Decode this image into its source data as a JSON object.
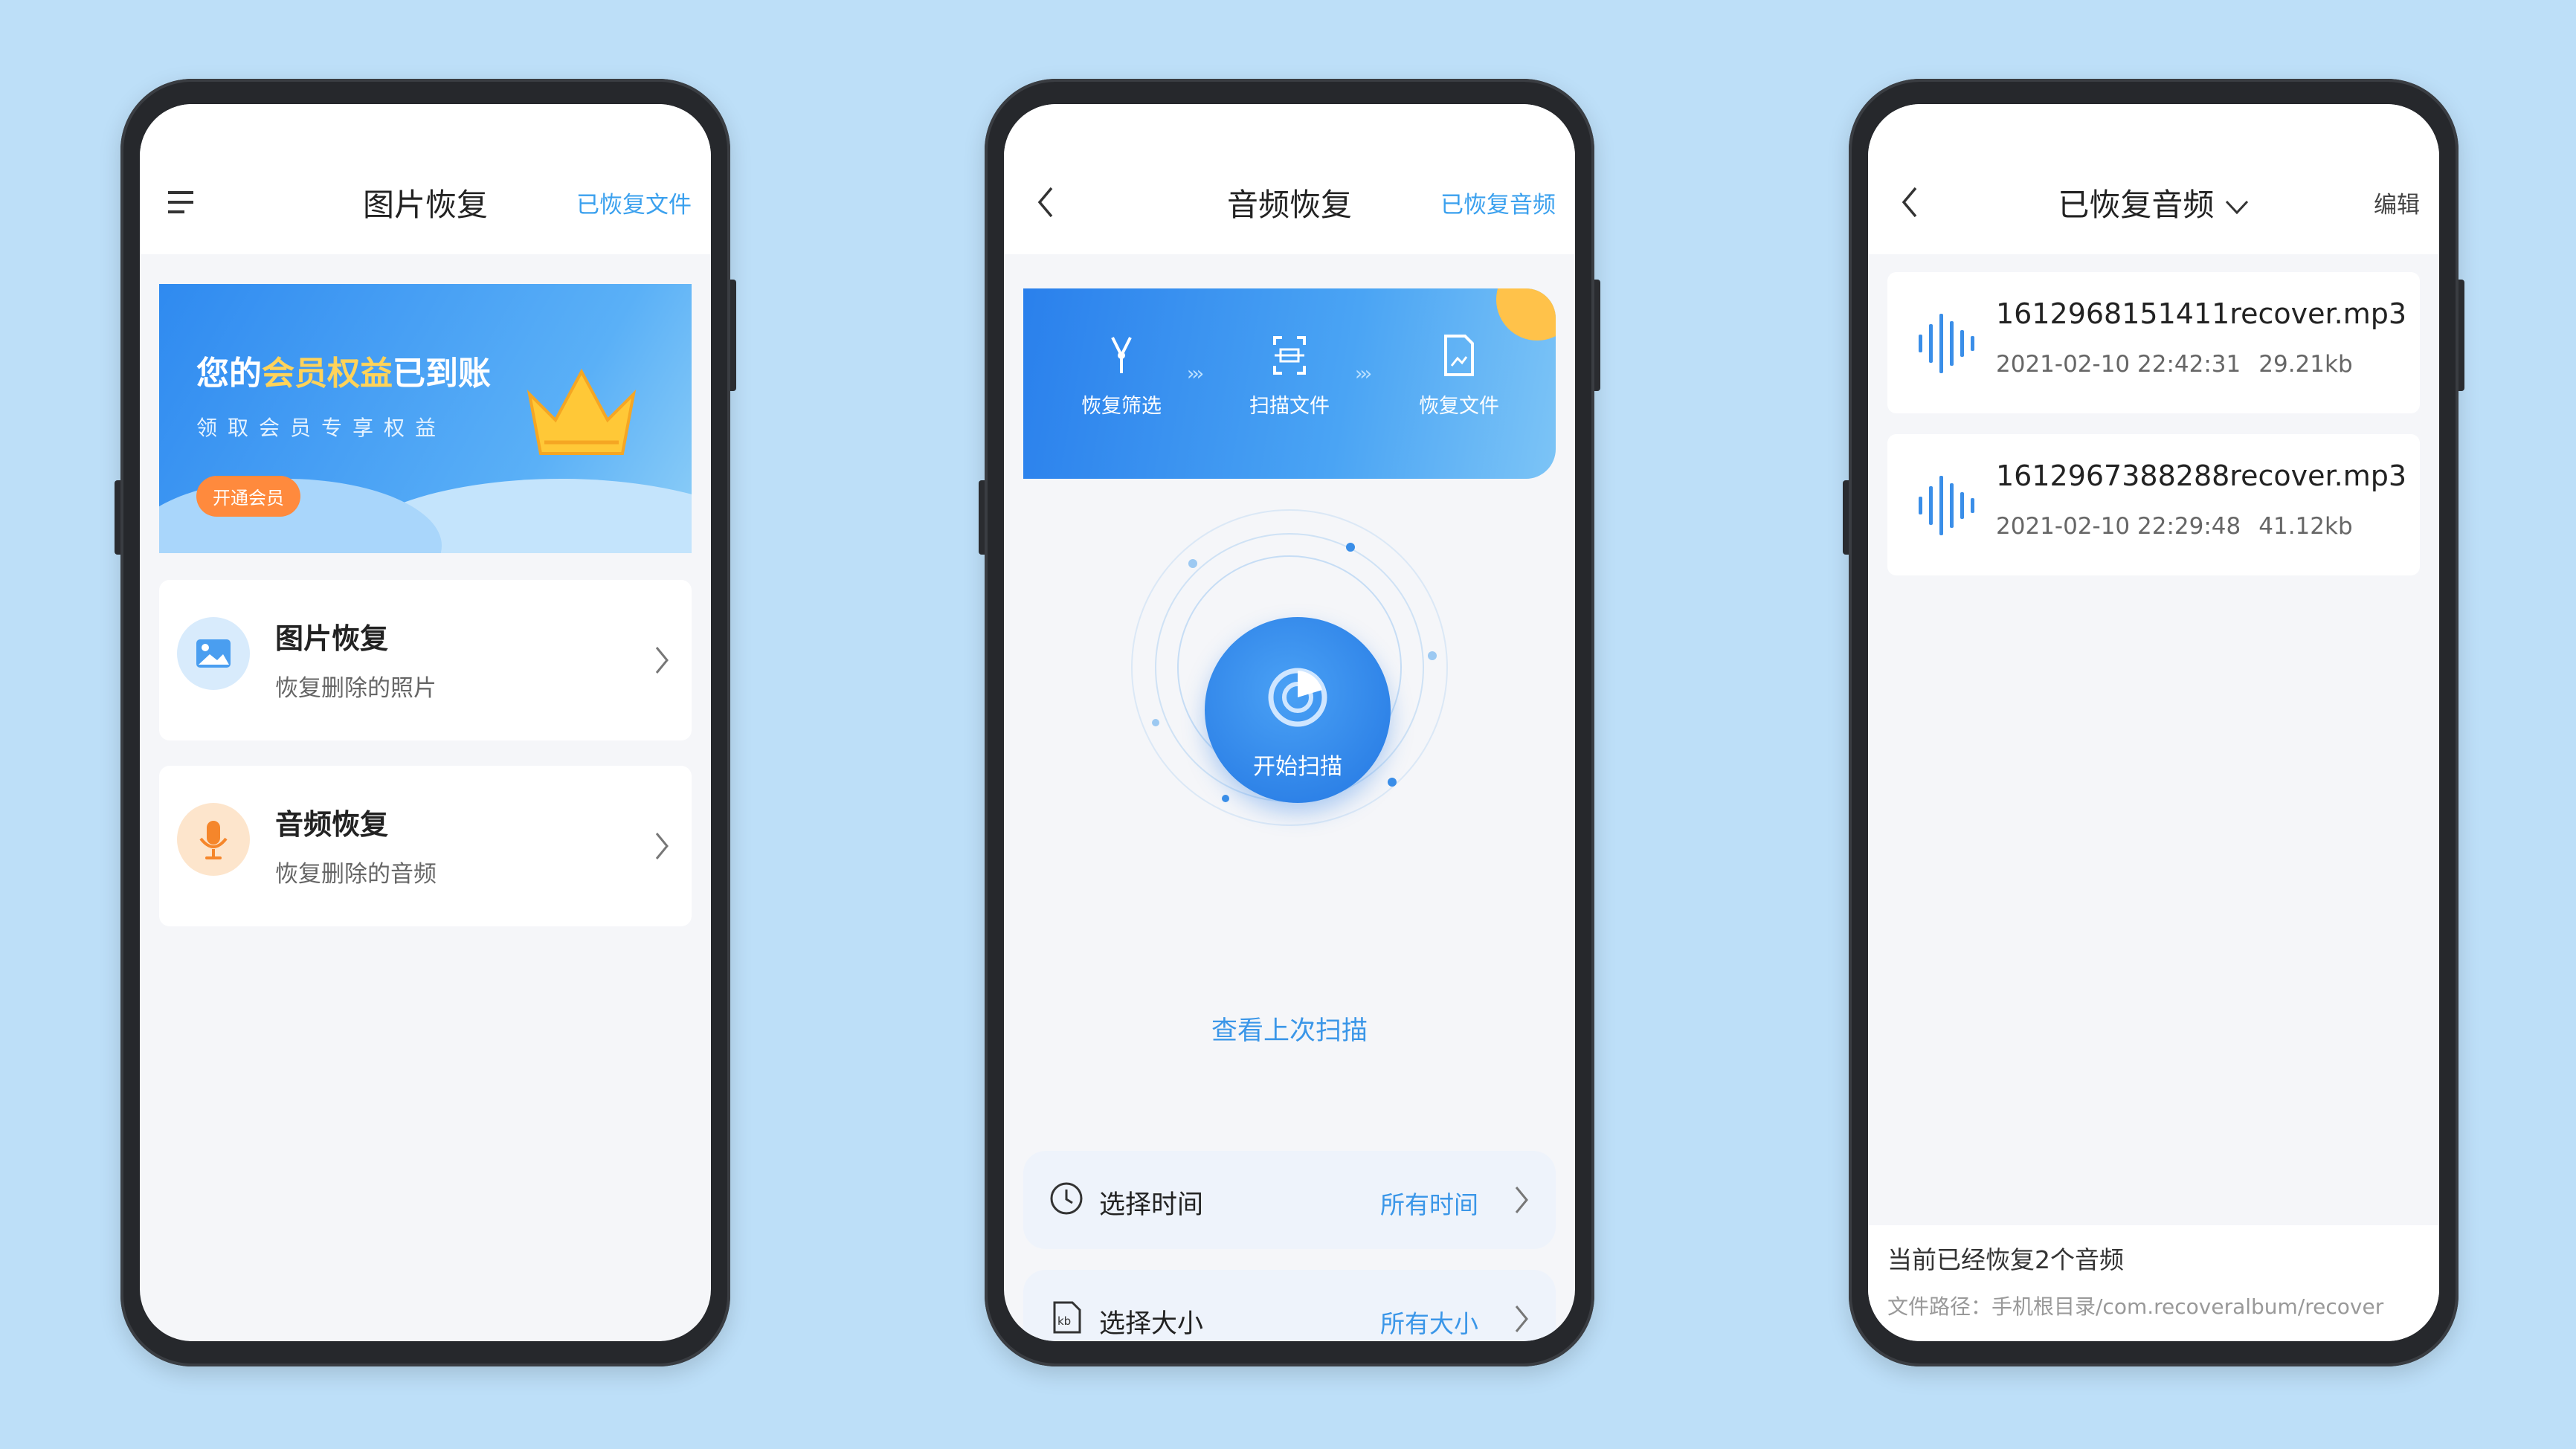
{
  "phone1": {
    "title": "图片恢复",
    "right_action": "已恢复文件",
    "banner": {
      "title_pre": "您的",
      "title_highlight": "会员权益",
      "title_post": "已到账",
      "subtitle": "领取会员专享权益",
      "button": "开通会员"
    },
    "menu": [
      {
        "title": "图片恢复",
        "subtitle": "恢复删除的照片",
        "icon": "image-icon"
      },
      {
        "title": "音频恢复",
        "subtitle": "恢复删除的音频",
        "icon": "microphone-icon"
      }
    ]
  },
  "phone2": {
    "title": "音频恢复",
    "right_action": "已恢复音频",
    "steps": [
      "恢复筛选",
      "扫描文件",
      "恢复文件"
    ],
    "scan_button": "开始扫描",
    "last_scan": "查看上次扫描",
    "options": [
      {
        "label": "选择时间",
        "value": "所有时间",
        "icon": "clock-icon"
      },
      {
        "label": "选择大小",
        "value": "所有大小",
        "icon": "kb-file-icon"
      }
    ]
  },
  "phone3": {
    "title": "已恢复音频",
    "right_action": "编辑",
    "files": [
      {
        "name": "1612968151411recover.mp3",
        "date": "2021-02-10 22:42:31",
        "size": "29.21kb"
      },
      {
        "name": "1612967388288recover.mp3",
        "date": "2021-02-10 22:29:48",
        "size": "41.12kb"
      }
    ],
    "footer_title": "当前已经恢复2个音频",
    "footer_path": "文件路径：手机根目录/com.recoveralbum/recover"
  },
  "colors": {
    "background": "#bddff8",
    "accent": "#3aa0ee",
    "banner_blue": "#2f8af0",
    "orange": "#ff8a3d"
  }
}
